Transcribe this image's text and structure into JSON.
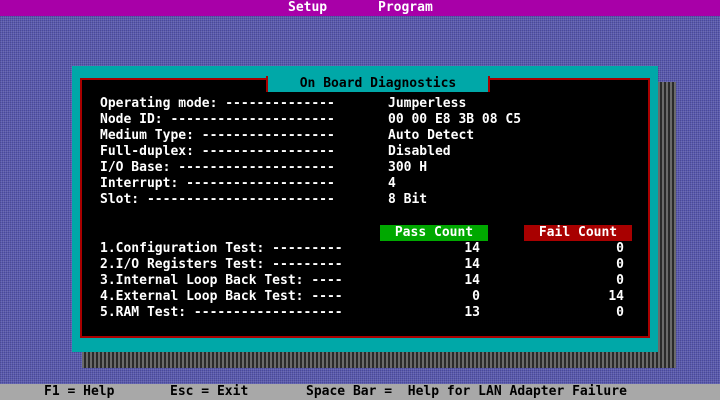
{
  "menubar": {
    "setup": "Setup",
    "program": "Program"
  },
  "window": {
    "title": "On Board Diagnostics"
  },
  "settings": [
    {
      "label": "Operating mode: --------------",
      "value": "Jumperless"
    },
    {
      "label": "Node ID: ---------------------",
      "value": "00 00 E8 3B 08 C5"
    },
    {
      "label": "Medium Type: -----------------",
      "value": "Auto Detect"
    },
    {
      "label": "Full-duplex: -----------------",
      "value": "Disabled"
    },
    {
      "label": "I/O Base: --------------------",
      "value": "300 H"
    },
    {
      "label": "Interrupt: -------------------",
      "value": "4"
    },
    {
      "label": "Slot: ------------------------",
      "value": "8 Bit"
    }
  ],
  "tests": {
    "pass_header": "Pass Count",
    "fail_header": "Fail Count",
    "rows": [
      {
        "label": "1.Configuration Test: ---------",
        "pass": "14",
        "fail": "0"
      },
      {
        "label": "2.I/O Registers Test: ---------",
        "pass": "14",
        "fail": "0"
      },
      {
        "label": "3.Internal Loop Back Test: ----",
        "pass": "14",
        "fail": "0"
      },
      {
        "label": "4.External Loop Back Test: ----",
        "pass": "0",
        "fail": "14"
      },
      {
        "label": "5.RAM Test: -------------------",
        "pass": "13",
        "fail": "0"
      }
    ]
  },
  "footer": {
    "help": "F1 = Help",
    "exit": "Esc = Exit",
    "space": "Space Bar =  Help for LAN Adapter Failure"
  },
  "colors": {
    "desktop": "#5a5ab0",
    "menubar": "#a800a8",
    "window": "#00a8a8",
    "panel": "#000000",
    "pass": "#00a800",
    "fail": "#a80000",
    "footer": "#a8a8a8"
  }
}
